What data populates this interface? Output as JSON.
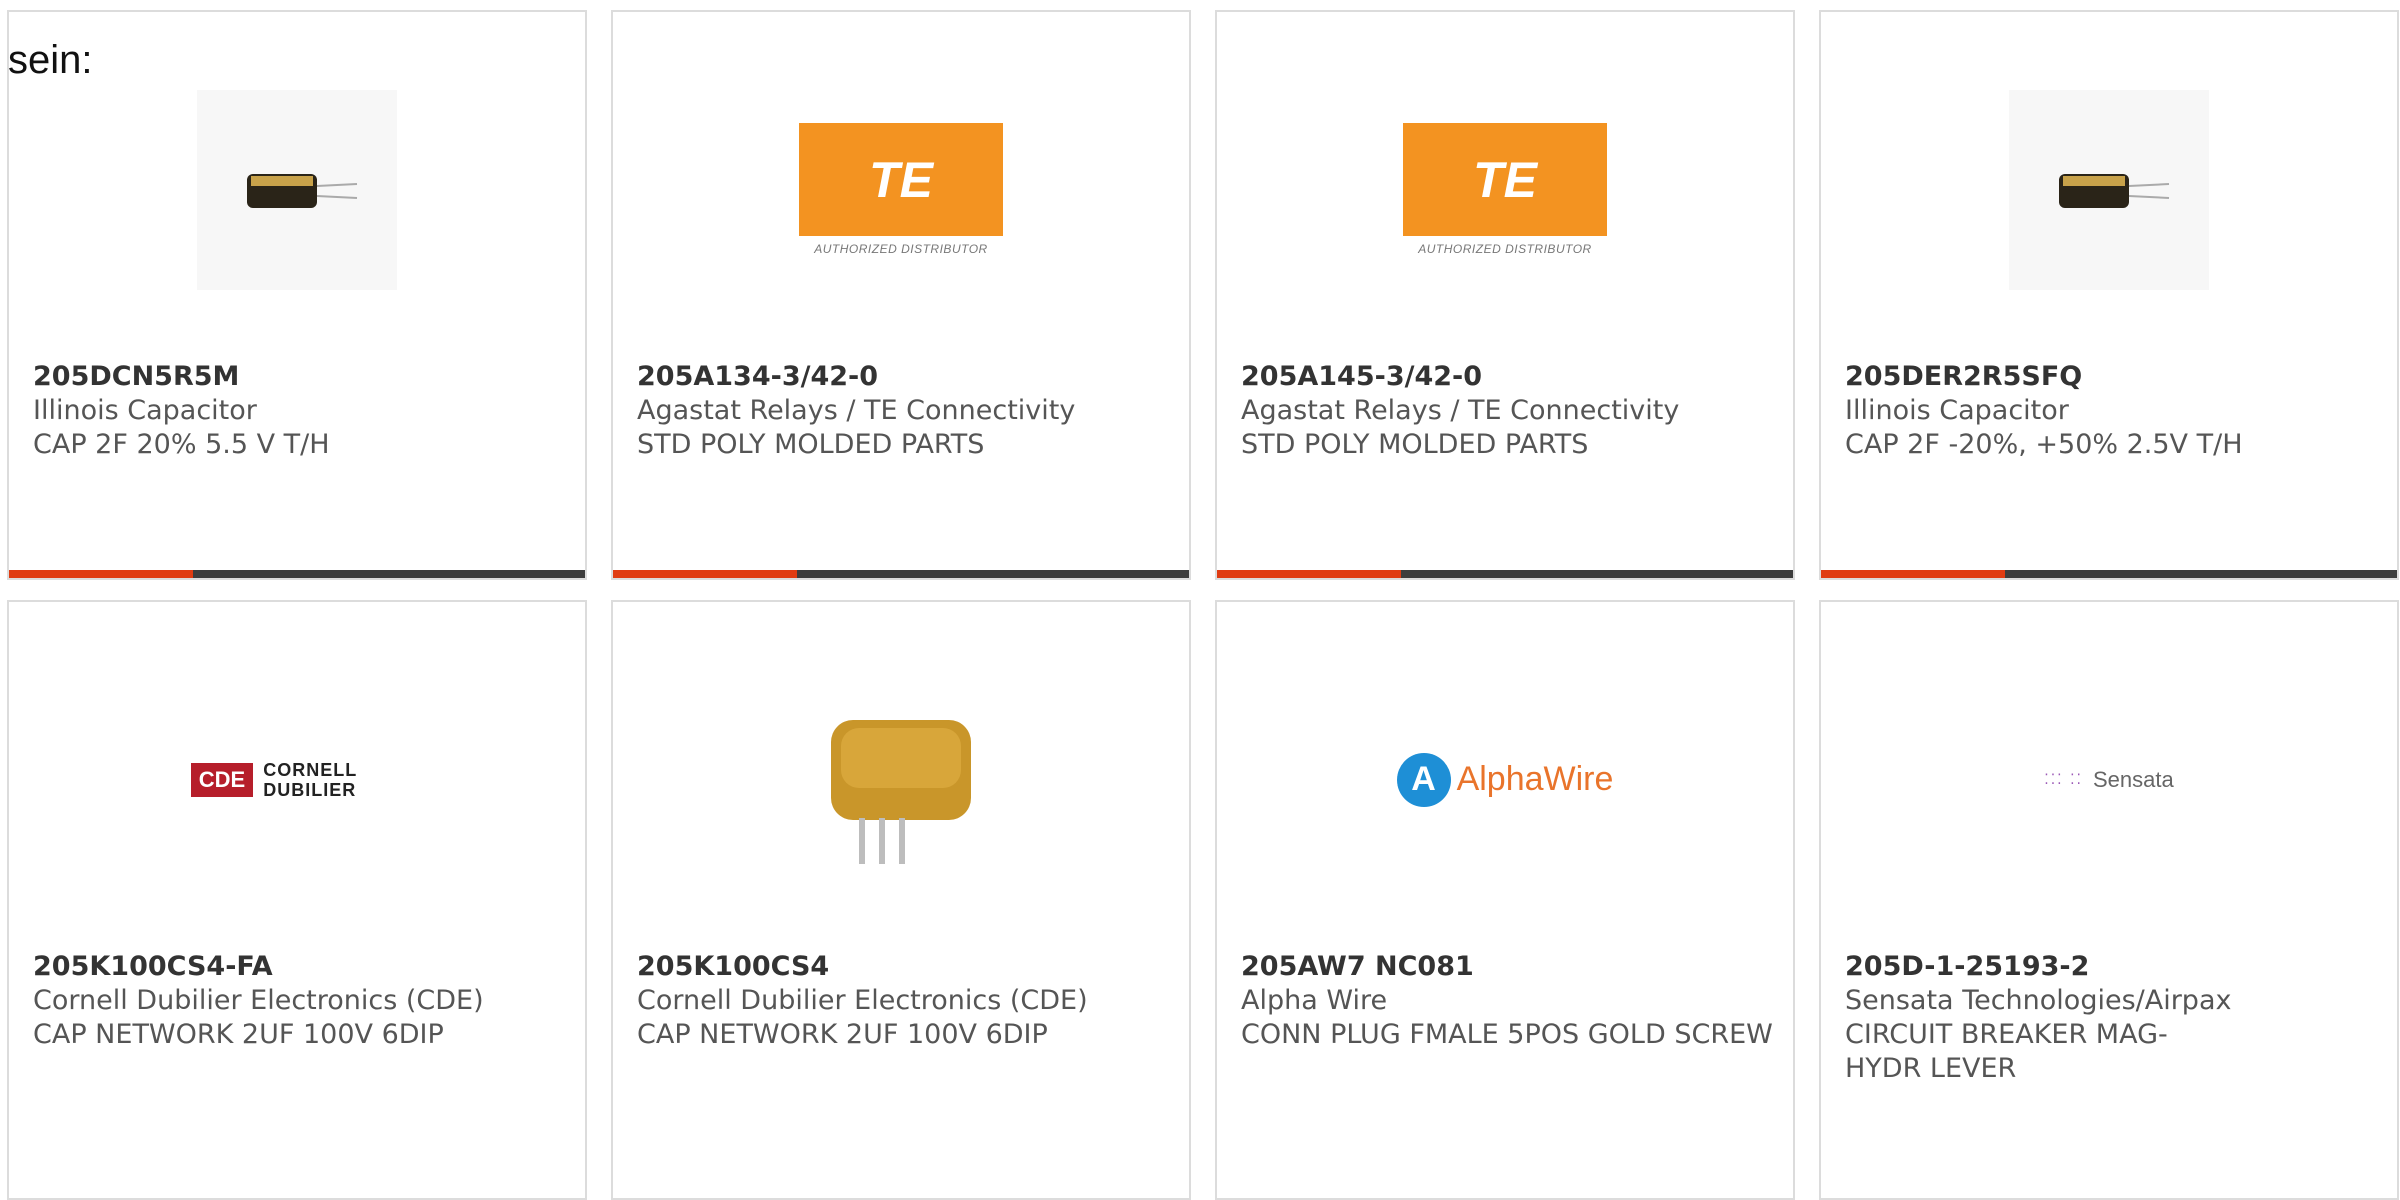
{
  "intro_text": "sein:",
  "cards": [
    {
      "part": "205DCN5R5M",
      "maker": "Illinois Capacitor",
      "desc": "CAP 2F 20% 5.5 V T/H",
      "image": "capacitor-photo"
    },
    {
      "part": "205A134-3/42-0",
      "maker": "Agastat Relays / TE Connectivity",
      "desc": "STD POLY MOLDED PARTS",
      "image": "te-logo",
      "logo_main": "TE",
      "logo_sub": "AUTHORIZED DISTRIBUTOR"
    },
    {
      "part": "205A145-3/42-0",
      "maker": "Agastat Relays / TE Connectivity",
      "desc": "STD POLY MOLDED PARTS",
      "image": "te-logo",
      "logo_main": "TE",
      "logo_sub": "AUTHORIZED DISTRIBUTOR"
    },
    {
      "part": "205DER2R5SFQ",
      "maker": "Illinois Capacitor",
      "desc": "CAP 2F -20%, +50% 2.5V T/H",
      "image": "capacitor-photo"
    },
    {
      "part": "205K100CS4-FA",
      "maker": "Cornell Dubilier Electronics (CDE)",
      "desc": "CAP NETWORK 2UF 100V 6DIP",
      "image": "cde-logo",
      "logo_main": "CDE",
      "logo_sub": "CORNELL DUBILIER"
    },
    {
      "part": "205K100CS4",
      "maker": "Cornell Dubilier Electronics (CDE)",
      "desc": "CAP NETWORK 2UF 100V 6DIP",
      "image": "capacitor-network-photo"
    },
    {
      "part": "205AW7 NC081",
      "maker": "Alpha Wire",
      "desc": "CONN PLUG FMALE 5POS GOLD SCREW",
      "image": "alphawire-logo",
      "logo_main": "AlphaWire"
    },
    {
      "part": "205D-1-25193-2",
      "maker": "Sensata Technologies/Airpax",
      "desc": "CIRCUIT BREAKER MAG-HYDR LEVER",
      "image": "sensata-logo",
      "logo_main": "Sensata"
    }
  ],
  "colors": {
    "accent": "#e03c12",
    "bar": "#3d3d3d",
    "border": "#dcdcdc"
  }
}
